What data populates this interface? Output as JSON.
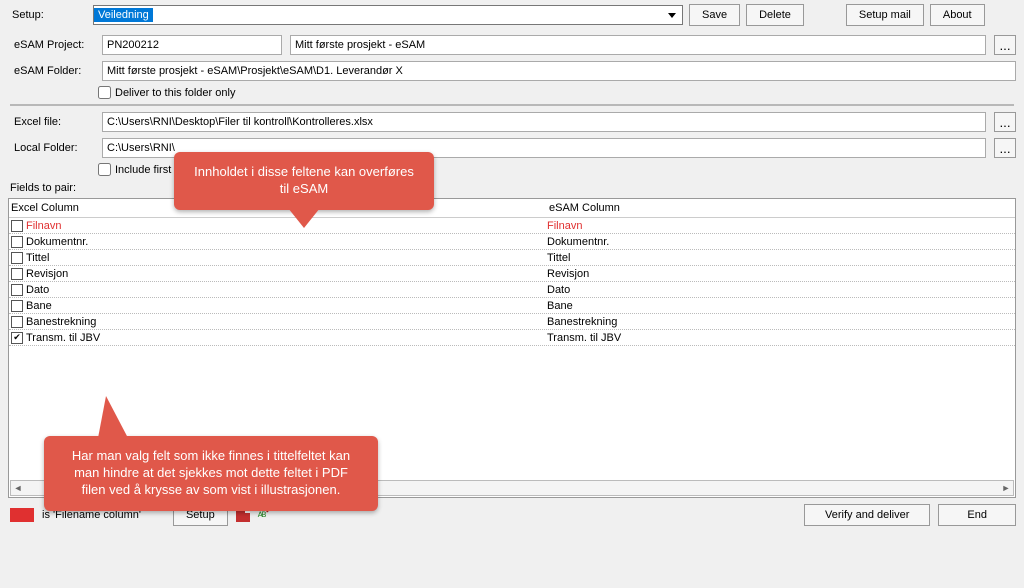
{
  "setup": {
    "label": "Setup:",
    "selected": "Veiledning",
    "save": "Save",
    "delete": "Delete",
    "setup_mail": "Setup mail",
    "about": "About"
  },
  "proj": {
    "esam_project_label": "eSAM Project:",
    "code": "PN200212",
    "name": "Mitt første prosjekt - eSAM",
    "browse": "..."
  },
  "folder": {
    "label": "eSAM Folder:",
    "path": "Mitt første prosjekt - eSAM\\Prosjekt\\eSAM\\D1. Leverandør X",
    "deliver_only": "Deliver to this folder only"
  },
  "excel": {
    "label": "Excel file:",
    "path": "C:\\Users\\RNI\\Desktop\\Filer til kontroll\\Kontrolleres.xlsx",
    "browse": "..."
  },
  "local": {
    "label": "Local Folder:",
    "path": "C:\\Users\\RNI\\",
    "browse": "...",
    "include_first": "Include first"
  },
  "fields": {
    "header": "Fields to pair:",
    "col1": "Excel Column",
    "col2": "eSAM Column",
    "rows": [
      {
        "excel": "Filnavn",
        "esam": "Filnavn",
        "checked": false,
        "red": true
      },
      {
        "excel": "Dokumentnr.",
        "esam": "Dokumentnr.",
        "checked": false,
        "red": false
      },
      {
        "excel": "Tittel",
        "esam": "Tittel",
        "checked": false,
        "red": false
      },
      {
        "excel": "Revisjon",
        "esam": "Revisjon",
        "checked": false,
        "red": false
      },
      {
        "excel": "Dato",
        "esam": "Dato",
        "checked": false,
        "red": false
      },
      {
        "excel": "Bane",
        "esam": "Bane",
        "checked": false,
        "red": false
      },
      {
        "excel": "Banestrekning",
        "esam": "Banestrekning",
        "checked": false,
        "red": false
      },
      {
        "excel": "Transm. til JBV",
        "esam": "Transm. til JBV",
        "checked": true,
        "red": false
      }
    ]
  },
  "legend": {
    "text": "is 'Filename column'"
  },
  "bottom": {
    "setup": "Setup",
    "verify": "Verify and deliver",
    "end": "End"
  },
  "callouts": {
    "top": "Innholdet i disse feltene kan overføres til eSAM",
    "bot": "Har man valg felt som ikke finnes i tittelfeltet kan man hindre at det sjekkes mot dette feltet i PDF filen ved å krysse av som vist i illustrasjonen."
  }
}
